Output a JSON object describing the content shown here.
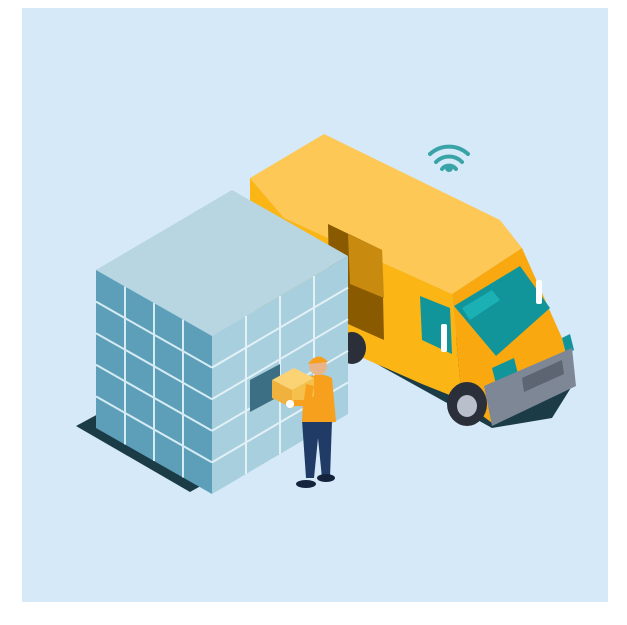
{
  "colors": {
    "background": "#d6e9f8",
    "van_body": "#fbb515",
    "van_roof": "#fdc856",
    "windshield": "#12959a",
    "bumper": "#7e8796",
    "shadow": "#1b3c47",
    "box_top": "#b7d6e2",
    "box_left": "#5d9eb9",
    "box_right": "#a8cfde",
    "worker_shirt": "#f7a01d",
    "worker_pants": "#1f3b66",
    "parcel": "#f5c14c",
    "wifi": "#3aa3a8"
  },
  "icons": [
    "wifi-icon"
  ]
}
